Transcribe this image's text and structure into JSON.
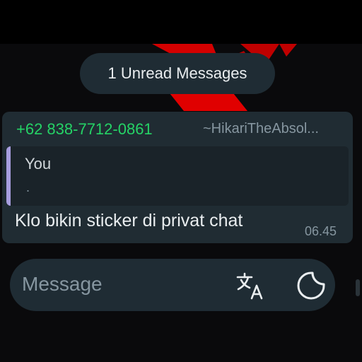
{
  "banner": {
    "unread_label": "1 Unread Messages"
  },
  "message": {
    "sender_number": "+62 838-7712-0861",
    "sender_name": "~HikariTheAbsol...",
    "reply": {
      "author": "You",
      "text": "."
    },
    "text": "Klo bikin sticker di privat chat",
    "time": "06.45"
  },
  "composer": {
    "placeholder": "Message"
  },
  "icons": {
    "translate": "translate-icon",
    "sticker": "sticker-icon"
  },
  "colors": {
    "sender_green": "#25d366",
    "quote_bar": "#a79dde",
    "bubble_bg": "#202c33",
    "wallpaper_accent": "#d40000"
  }
}
